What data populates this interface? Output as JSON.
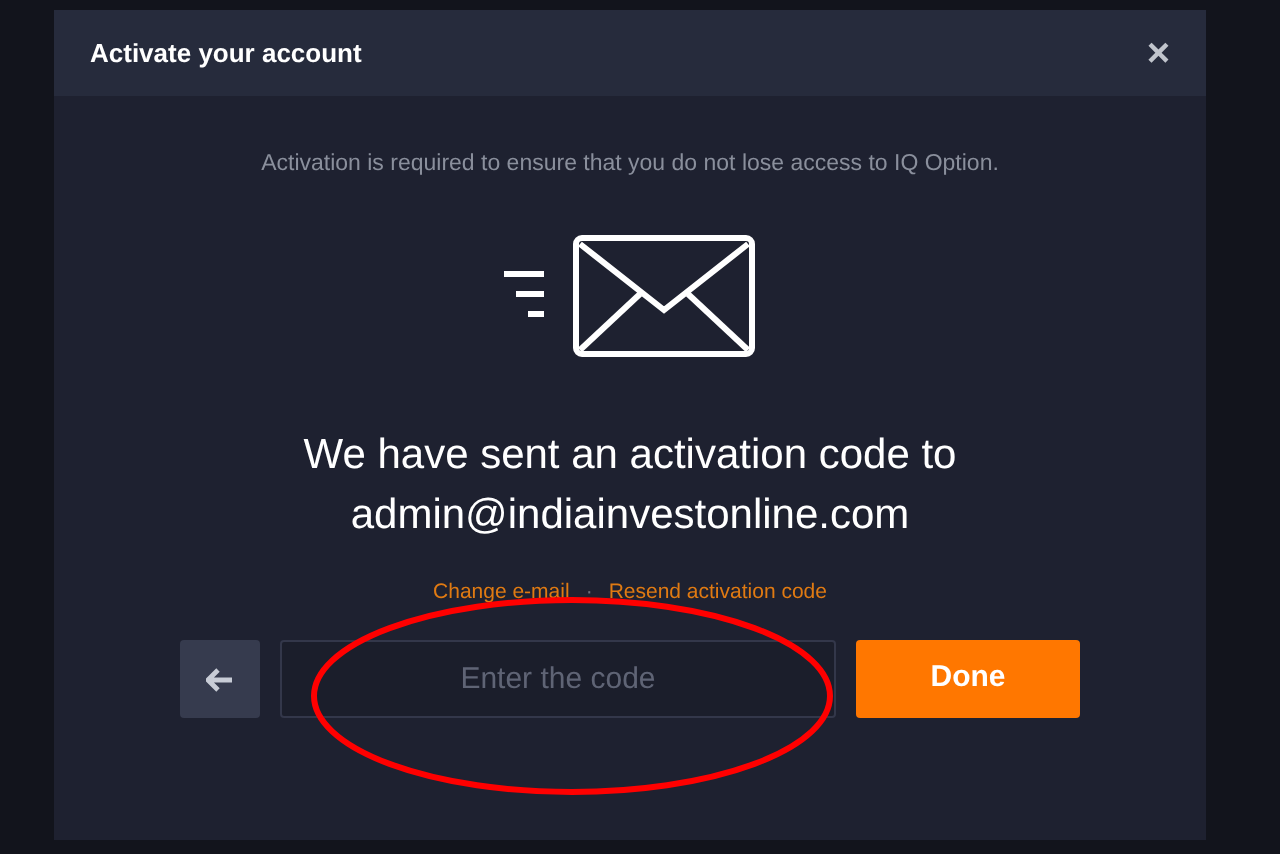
{
  "dialog": {
    "title": "Activate your account",
    "close": "×",
    "notice": "Activation is required to ensure that you do not lose access to IQ Option.",
    "heading": "We have sent an activation code to",
    "email": "admin@indiainvestonline.com",
    "links": [
      "Change e-mail",
      "Resend activation code"
    ],
    "separator": "·",
    "code_field": {
      "placeholder": "Enter the code"
    },
    "done_button": "Done"
  }
}
